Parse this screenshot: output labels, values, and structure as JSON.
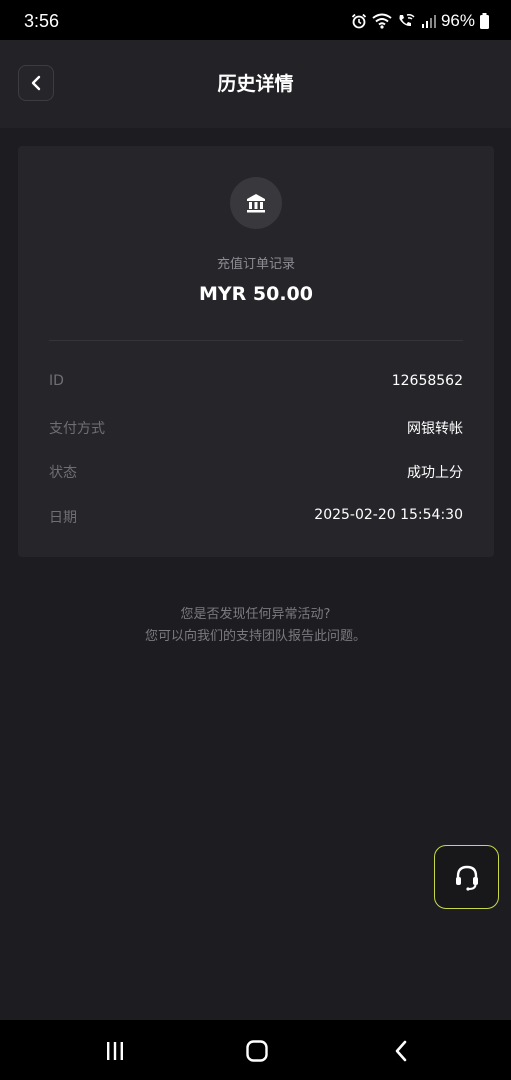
{
  "status_bar": {
    "time": "3:56",
    "battery": "96%"
  },
  "header": {
    "title": "历史详情"
  },
  "card": {
    "record_title": "充值订单记录",
    "amount": "MYR 50.00",
    "rows": [
      {
        "label": "ID",
        "value": "12658562"
      },
      {
        "label": "支付方式",
        "value": "网银转帐"
      },
      {
        "label": "状态",
        "value": "成功上分"
      },
      {
        "label": "日期",
        "value": "2025-02-20 15:54:30"
      }
    ]
  },
  "help": {
    "line1": "您是否发现任何异常活动?",
    "line2": "您可以向我们的支持团队报告此问题。"
  },
  "colors": {
    "background": "#1d1d21",
    "card": "#25252a",
    "accent_border": "#c8d84a"
  },
  "icons": {
    "back": "chevron-left-icon",
    "bank": "bank-icon",
    "support": "headset-icon"
  }
}
